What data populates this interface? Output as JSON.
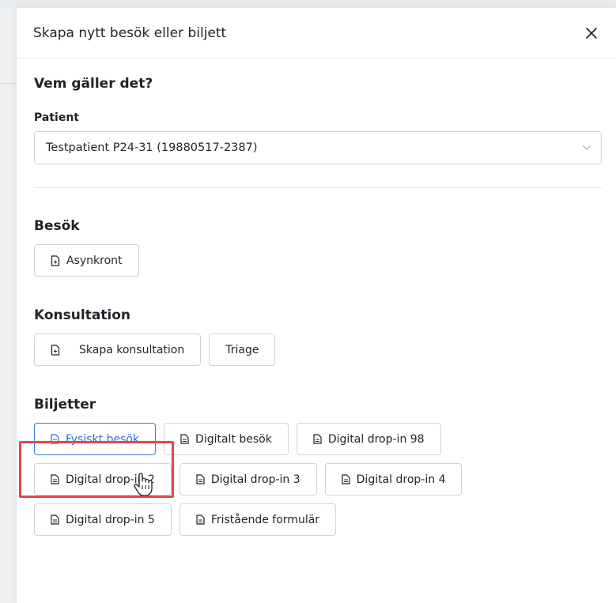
{
  "modal": {
    "title": "Skapa nytt besök eller biljett"
  },
  "who": {
    "heading": "Vem gäller det?",
    "patient_label": "Patient",
    "patient_value": "Testpatient P24-31 (19880517-2387)"
  },
  "besok": {
    "heading": "Besök",
    "buttons": [
      "Asynkront"
    ]
  },
  "konsultation": {
    "heading": "Konsultation",
    "buttons": [
      "Skapa konsultation",
      "Triage"
    ]
  },
  "biljetter": {
    "heading": "Biljetter",
    "buttons": [
      "Fysiskt besök",
      "Digitalt besök",
      "Digital drop-in 98",
      "Digital drop-in 2",
      "Digital drop-in 3",
      "Digital drop-in 4",
      "Digital drop-in 5",
      "Fristående formulär"
    ],
    "selected": "Fysiskt besök"
  },
  "colors": {
    "accent": "#3d7ad6",
    "highlight": "#e04a4a"
  },
  "icons": {
    "close": "close-icon",
    "dropdown": "chevron-down-icon",
    "document": "document-icon",
    "document_plus": "document-plus-icon",
    "cursor": "hand-pointer-icon"
  }
}
